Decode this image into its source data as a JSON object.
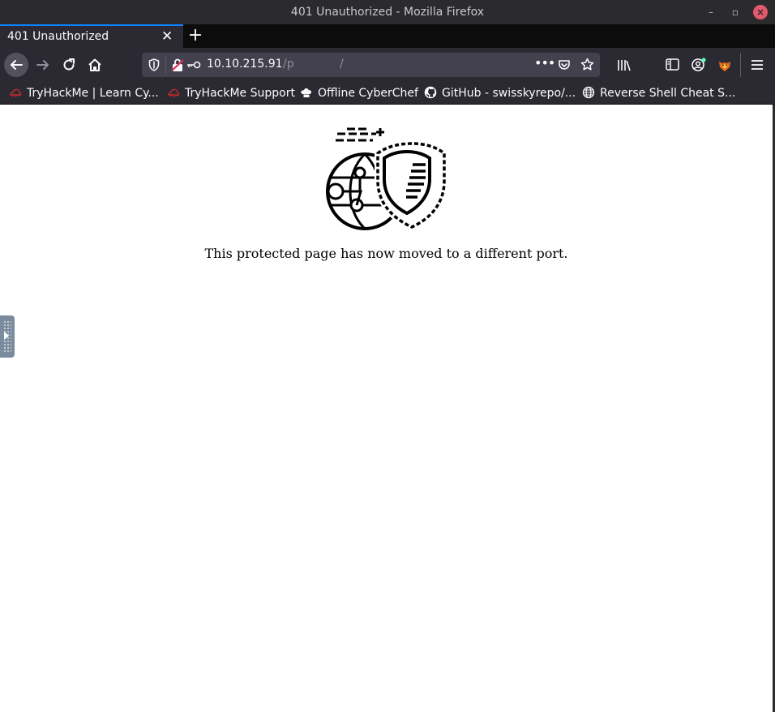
{
  "window": {
    "title": "401 Unauthorized - Mozilla Firefox"
  },
  "tab": {
    "title": "401 Unauthorized"
  },
  "urlbar": {
    "host": "10.10.215.91",
    "path": "/p",
    "trailing": "/"
  },
  "bookmarks": [
    {
      "label": "TryHackMe | Learn Cy...",
      "icon": "tryhackme-icon"
    },
    {
      "label": "TryHackMe Support",
      "icon": "tryhackme-icon"
    },
    {
      "label": "Offline CyberChef",
      "icon": "chef-hat-icon"
    },
    {
      "label": "GitHub - swisskyrepo/...",
      "icon": "github-icon"
    },
    {
      "label": "Reverse Shell Cheat S...",
      "icon": "globe-icon"
    }
  ],
  "page": {
    "message": "This protected page has now moved to a different port."
  },
  "colors": {
    "accent": "#0a84ff",
    "chrome": "#2b2a33",
    "close": "#e25a6b",
    "tryhackme": "#c42b2b"
  }
}
